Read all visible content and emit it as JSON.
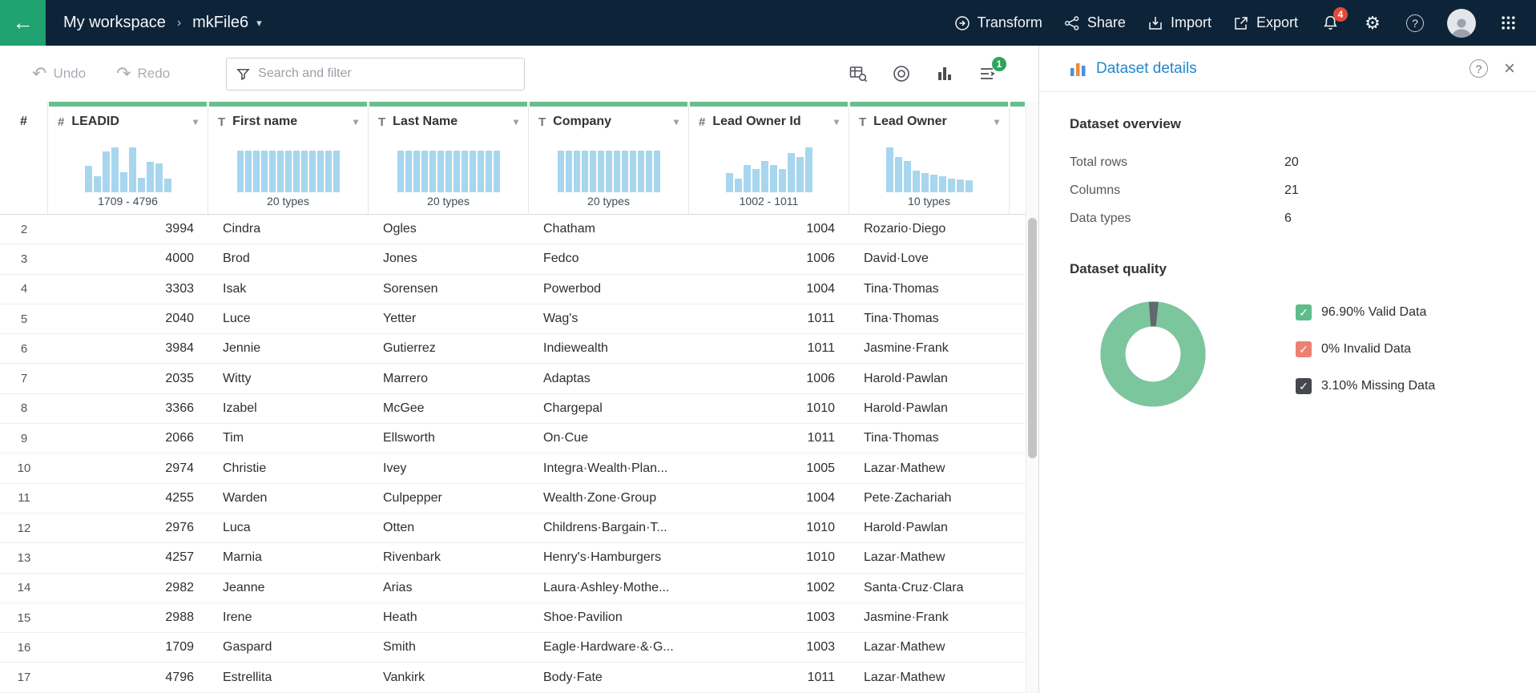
{
  "topbar": {
    "breadcrumb": {
      "workspace": "My workspace",
      "separator": "›",
      "file": "mkFile6"
    },
    "actions": [
      {
        "id": "transform",
        "label": "Transform"
      },
      {
        "id": "share",
        "label": "Share"
      },
      {
        "id": "import",
        "label": "Import"
      },
      {
        "id": "export",
        "label": "Export"
      }
    ],
    "notification_badge": "4"
  },
  "toolbar": {
    "undo": "Undo",
    "redo": "Redo",
    "search_placeholder": "Search and filter",
    "steps_badge": "1"
  },
  "table": {
    "row_number_header": "#",
    "columns": [
      {
        "type_glyph": "#",
        "label": "LEADID",
        "caption": "1709 - 4796",
        "align": "right",
        "histogram": [
          0.59,
          0.36,
          0.91,
          1.0,
          0.45,
          1.0,
          0.32,
          0.68,
          0.64,
          0.3
        ]
      },
      {
        "type_glyph": "T",
        "label": "First name",
        "caption": "20 types",
        "align": "left",
        "histogram": [
          0.92,
          0.92,
          0.92,
          0.92,
          0.92,
          0.92,
          0.92,
          0.92,
          0.92,
          0.92,
          0.92,
          0.92,
          0.92
        ]
      },
      {
        "type_glyph": "T",
        "label": "Last Name",
        "caption": "20 types",
        "align": "left",
        "histogram": [
          0.92,
          0.92,
          0.92,
          0.92,
          0.92,
          0.92,
          0.92,
          0.92,
          0.92,
          0.92,
          0.92,
          0.92,
          0.92
        ]
      },
      {
        "type_glyph": "T",
        "label": "Company",
        "caption": "20 types",
        "align": "left",
        "histogram": [
          0.92,
          0.92,
          0.92,
          0.92,
          0.92,
          0.92,
          0.92,
          0.92,
          0.92,
          0.92,
          0.92,
          0.92,
          0.92
        ]
      },
      {
        "type_glyph": "#",
        "label": "Lead Owner Id",
        "caption": "1002 - 1011",
        "align": "right",
        "histogram": [
          0.43,
          0.3,
          0.6,
          0.52,
          0.7,
          0.6,
          0.52,
          0.87,
          0.78,
          1.0
        ]
      },
      {
        "type_glyph": "T",
        "label": "Lead Owner",
        "caption": "10 types",
        "align": "left",
        "histogram": [
          1.0,
          0.78,
          0.7,
          0.48,
          0.43,
          0.39,
          0.35,
          0.3,
          0.28,
          0.26
        ]
      }
    ],
    "rows": [
      {
        "n": "2",
        "cells": [
          "3994",
          "Cindra",
          "Ogles",
          "Chatham",
          "1004",
          "Rozario·Diego"
        ]
      },
      {
        "n": "3",
        "cells": [
          "4000",
          "Brod",
          "Jones",
          "Fedco",
          "1006",
          "David·Love"
        ]
      },
      {
        "n": "4",
        "cells": [
          "3303",
          "Isak",
          "Sorensen",
          "Powerbod",
          "1004",
          "Tina·Thomas"
        ]
      },
      {
        "n": "5",
        "cells": [
          "2040",
          "Luce",
          "Yetter",
          "Wag's",
          "1011",
          "Tina·Thomas"
        ]
      },
      {
        "n": "6",
        "cells": [
          "3984",
          "Jennie",
          "Gutierrez",
          "Indiewealth",
          "1011",
          "Jasmine·Frank"
        ]
      },
      {
        "n": "7",
        "cells": [
          "2035",
          "Witty",
          "Marrero",
          "Adaptas",
          "1006",
          "Harold·Pawlan"
        ]
      },
      {
        "n": "8",
        "cells": [
          "3366",
          "Izabel",
          "McGee",
          "Chargepal",
          "1010",
          "Harold·Pawlan"
        ]
      },
      {
        "n": "9",
        "cells": [
          "2066",
          "Tim",
          "Ellsworth",
          "On·Cue",
          "1011",
          "Tina·Thomas"
        ]
      },
      {
        "n": "10",
        "cells": [
          "2974",
          "Christie",
          "Ivey",
          "Integra·Wealth·Plan...",
          "1005",
          "Lazar·Mathew"
        ]
      },
      {
        "n": "11",
        "cells": [
          "4255",
          "Warden",
          "Culpepper",
          "Wealth·Zone·Group",
          "1004",
          "Pete·Zachariah"
        ]
      },
      {
        "n": "12",
        "cells": [
          "2976",
          "Luca",
          "Otten",
          "Childrens·Bargain·T...",
          "1010",
          "Harold·Pawlan"
        ]
      },
      {
        "n": "13",
        "cells": [
          "4257",
          "Marnia",
          "Rivenbark",
          "Henry's·Hamburgers",
          "1010",
          "Lazar·Mathew"
        ]
      },
      {
        "n": "14",
        "cells": [
          "2982",
          "Jeanne",
          "Arias",
          "Laura·Ashley·Mothe...",
          "1002",
          "Santa·Cruz·Clara"
        ]
      },
      {
        "n": "15",
        "cells": [
          "2988",
          "Irene",
          "Heath",
          "Shoe·Pavilion",
          "1003",
          "Jasmine·Frank"
        ]
      },
      {
        "n": "16",
        "cells": [
          "1709",
          "Gaspard",
          "Smith",
          "Eagle·Hardware·&·G...",
          "1003",
          "Lazar·Mathew"
        ]
      },
      {
        "n": "17",
        "cells": [
          "4796",
          "Estrellita",
          "Vankirk",
          "Body·Fate",
          "1011",
          "Lazar·Mathew"
        ]
      }
    ]
  },
  "panel": {
    "title": "Dataset details",
    "overview_title": "Dataset overview",
    "overview": [
      {
        "label": "Total rows",
        "value": "20"
      },
      {
        "label": "Columns",
        "value": "21"
      },
      {
        "label": "Data types",
        "value": "6"
      }
    ],
    "quality_title": "Dataset quality",
    "quality_legend": [
      {
        "label": "96.90% Valid Data",
        "color": "#5fbd8b"
      },
      {
        "label": "0% Invalid Data",
        "color": "#ec8173"
      },
      {
        "label": "3.10% Missing Data",
        "color": "#44484c"
      }
    ],
    "chart_data": {
      "type": "pie",
      "labels": [
        "Valid Data",
        "Invalid Data",
        "Missing Data"
      ],
      "values": [
        96.9,
        0,
        3.1
      ],
      "colors": [
        "#7cc69e",
        "#ec8173",
        "#63686c"
      ]
    }
  },
  "colors": {
    "topbar_bg": "#0d2338",
    "accent_green": "#67bf8b",
    "histogram_blue": "#a7d6ee",
    "title_blue": "#2288cb",
    "badge_red": "#e5493a",
    "badge_green": "#2fa35c"
  }
}
